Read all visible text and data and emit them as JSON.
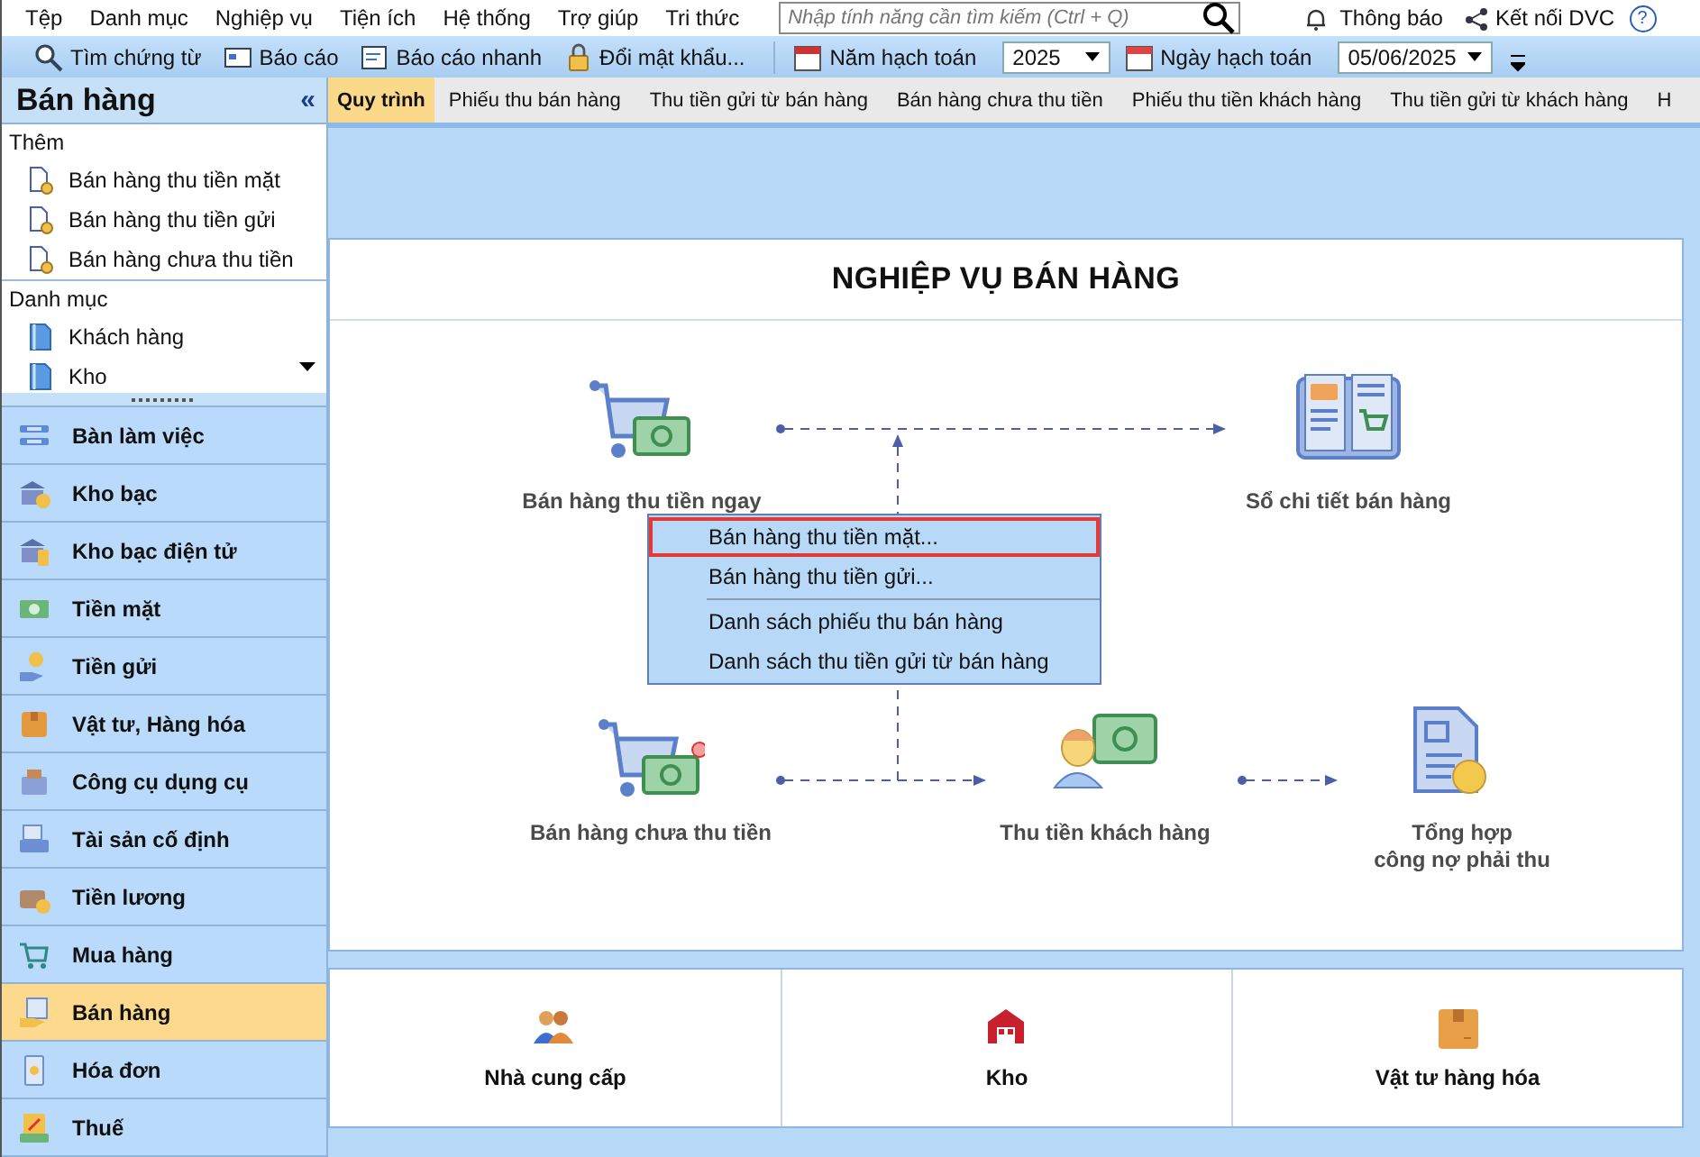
{
  "menu_bar": {
    "items": [
      "Tệp",
      "Danh mục",
      "Nghiệp vụ",
      "Tiện ích",
      "Hệ thống",
      "Trợ giúp",
      "Tri thức"
    ],
    "search": {
      "placeholder": "Nhập tính năng cần tìm kiếm (Ctrl + Q)"
    },
    "notifications": "Thông báo",
    "connect": "Kết nối DVC",
    "help": "?"
  },
  "toolbar": {
    "buttons": [
      "Tìm chứng từ",
      "Báo cáo",
      "Báo cáo nhanh",
      "Đổi mật khẩu..."
    ],
    "year_label": "Năm hạch toán",
    "year": "2025",
    "date_label": "Ngày hạch toán",
    "date": "05/06/2025"
  },
  "sidebar": {
    "title": "Bán hàng",
    "collapse": "«",
    "sections": [
      {
        "title": "Thêm",
        "items": [
          "Bán hàng thu tiền mặt",
          "Bán hàng thu tiền gửi",
          "Bán hàng chưa thu tiền"
        ]
      },
      {
        "title": "Danh mục",
        "items": [
          "Khách hàng",
          "Kho"
        ]
      }
    ],
    "nav": [
      {
        "label": "Bàn làm việc",
        "selected": false
      },
      {
        "label": "Kho bạc",
        "selected": false
      },
      {
        "label": "Kho bạc điện tử",
        "selected": false
      },
      {
        "label": "Tiền mặt",
        "selected": false
      },
      {
        "label": "Tiền gửi",
        "selected": false
      },
      {
        "label": "Vật tư, Hàng hóa",
        "selected": false
      },
      {
        "label": "Công cụ dụng cụ",
        "selected": false
      },
      {
        "label": "Tài sản cố định",
        "selected": false
      },
      {
        "label": "Tiền lương",
        "selected": false
      },
      {
        "label": "Mua hàng",
        "selected": false
      },
      {
        "label": "Bán hàng",
        "selected": true
      },
      {
        "label": "Hóa đơn",
        "selected": false
      },
      {
        "label": "Thuế",
        "selected": false
      }
    ]
  },
  "tabs": [
    {
      "label": "Quy trình",
      "selected": true
    },
    {
      "label": "Phiếu thu bán hàng",
      "selected": false
    },
    {
      "label": "Thu tiền gửi từ bán hàng",
      "selected": false
    },
    {
      "label": "Bán hàng chưa thu tiền",
      "selected": false
    },
    {
      "label": "Phiếu thu tiền khách hàng",
      "selected": false
    },
    {
      "label": "Thu tiền gửi từ khách hàng",
      "selected": false
    },
    {
      "label": "H",
      "selected": false
    }
  ],
  "diagram": {
    "title": "NGHIỆP VỤ BÁN HÀNG",
    "nodes": [
      "Bán hàng thu tiền ngay",
      "Sổ chi tiết bán hàng",
      "Bán hàng chưa thu tiền",
      "Thu tiền khách hàng",
      "Tổng hợp\ncông nợ phải thu"
    ]
  },
  "context_menu": {
    "groups": [
      [
        {
          "label": "Bán hàng thu tiền mặt...",
          "selected": true
        },
        {
          "label": "Bán hàng thu tiền gửi...",
          "selected": false
        }
      ],
      [
        {
          "label": "Danh sách phiếu thu bán hàng",
          "selected": false
        },
        {
          "label": "Danh sách thu tiền gửi từ bán hàng",
          "selected": false
        }
      ]
    ]
  },
  "shortcuts": [
    "Nhà cung cấp",
    "Kho",
    "Vật tư hàng hóa"
  ]
}
